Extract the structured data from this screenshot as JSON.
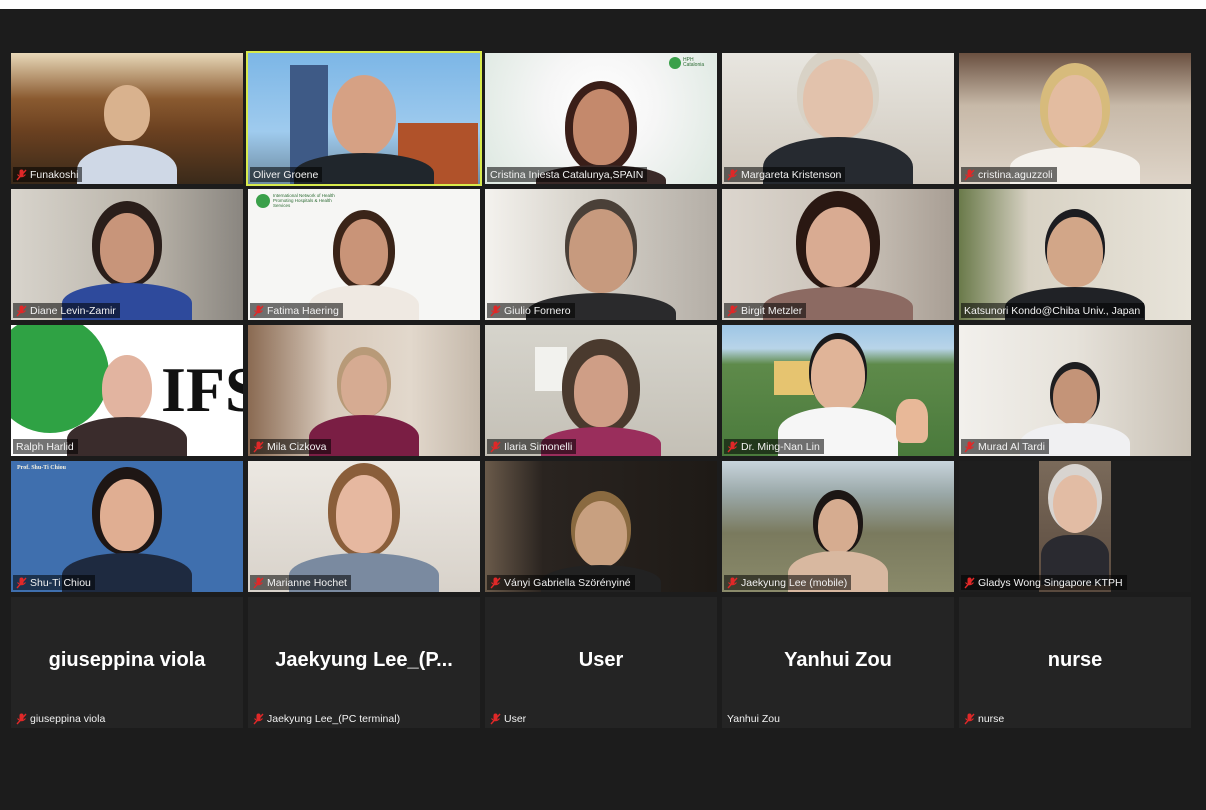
{
  "colors": {
    "background": "#1c1c1c",
    "active_speaker_border": "#d8ea4c",
    "muted_icon": "#e02828"
  },
  "participants": [
    {
      "name": "Funakoshi",
      "muted": true
    },
    {
      "name": "Oliver Groene",
      "muted": false,
      "active": true
    },
    {
      "name": "Cristina Iniesta Catalunya,SPAIN",
      "muted": false,
      "overlay_text": "HPH Catalonia"
    },
    {
      "name": "Margareta Kristenson",
      "muted": true
    },
    {
      "name": "cristina.aguzzoli",
      "muted": true
    },
    {
      "name": "Diane Levin-Zamir",
      "muted": true
    },
    {
      "name": "Fatima Haering",
      "muted": true,
      "overlay_text": "International Network of Health Promoting Hospitals & Health Services"
    },
    {
      "name": "Giulio Fornero",
      "muted": true
    },
    {
      "name": "Birgit Metzler",
      "muted": true
    },
    {
      "name": "Katsunori Kondo@Chiba Univ., Japan",
      "muted": false
    },
    {
      "name": "Ralph Harlid",
      "muted": false,
      "overlay_text": "IFS"
    },
    {
      "name": "Mila Cizkova",
      "muted": true
    },
    {
      "name": "Ilaria Simonelli",
      "muted": true
    },
    {
      "name": "Dr. Ming-Nan Lin",
      "muted": true
    },
    {
      "name": "Murad Al Tardi",
      "muted": true
    },
    {
      "name": "Shu-Ti Chiou",
      "muted": true,
      "overlay_text": "Prof. Shu-Ti Chiou"
    },
    {
      "name": "Marianne Hochet",
      "muted": true
    },
    {
      "name": "Ványi Gabriella Szörényiné",
      "muted": true
    },
    {
      "name": "Jaekyung Lee (mobile)",
      "muted": true
    },
    {
      "name": "Gladys Wong Singapore KTPH",
      "muted": true
    },
    {
      "name": "giuseppina viola",
      "muted": true,
      "display": "giuseppina viola"
    },
    {
      "name": "Jaekyung Lee_(PC terminal)",
      "muted": true,
      "display": "Jaekyung  Lee_(P..."
    },
    {
      "name": "User",
      "muted": true,
      "display": "User"
    },
    {
      "name": "Yanhui Zou",
      "muted": false,
      "display": "Yanhui Zou"
    },
    {
      "name": "nurse",
      "muted": true,
      "display": "nurse"
    }
  ]
}
